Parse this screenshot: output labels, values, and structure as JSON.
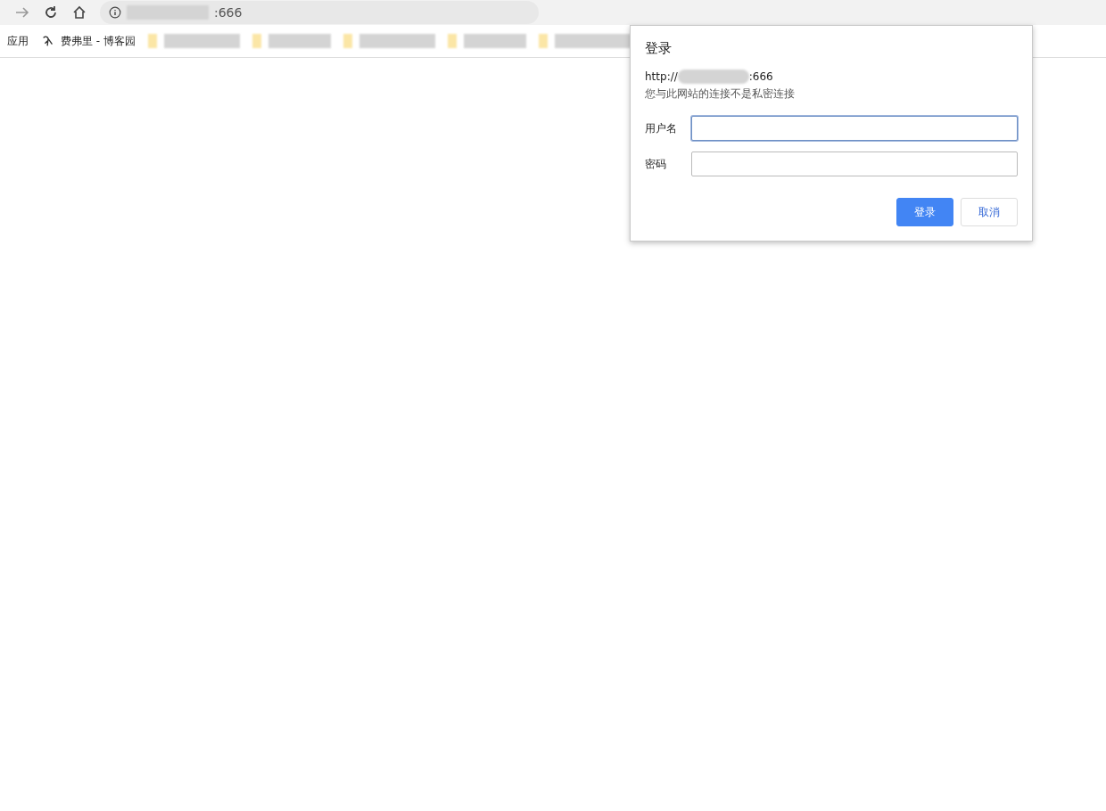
{
  "toolbar": {
    "address": {
      "suffix": ":666"
    }
  },
  "bookmarks": [
    {
      "kind": "apps",
      "label": "应用"
    },
    {
      "kind": "site",
      "label": "费弗里 - 博客园"
    },
    {
      "kind": "blurred"
    },
    {
      "kind": "blurred"
    },
    {
      "kind": "blurred"
    },
    {
      "kind": "blurred"
    },
    {
      "kind": "blurred"
    }
  ],
  "dialog": {
    "title": "登录",
    "origin_prefix": "http://",
    "origin_suffix": ":666",
    "warning": "您与此网站的连接不是私密连接",
    "fields": [
      {
        "label": "用户名",
        "focused": true
      },
      {
        "label": "密码",
        "focused": false
      }
    ],
    "buttons": [
      {
        "label": "登录",
        "primary": true
      },
      {
        "label": "取消",
        "primary": false
      }
    ]
  }
}
